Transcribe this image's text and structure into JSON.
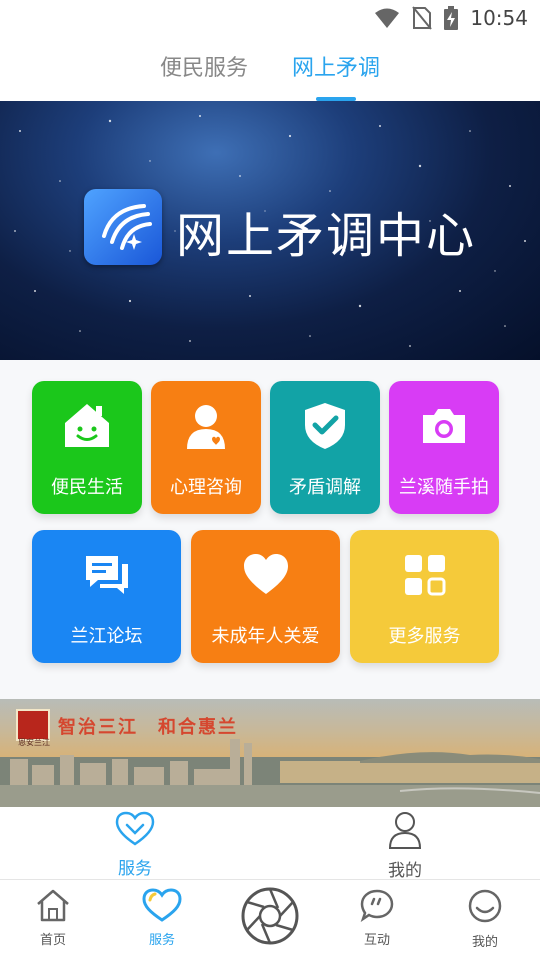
{
  "status": {
    "time": "10:54"
  },
  "tabs": [
    {
      "label": "便民服务",
      "active": false
    },
    {
      "label": "网上矛调",
      "active": true
    }
  ],
  "banner": {
    "title": "网上矛调中心"
  },
  "services": [
    {
      "label": "便民生活",
      "icon": "house-smile-icon",
      "color": "#1bc71b"
    },
    {
      "label": "心理咨询",
      "icon": "person-heart-icon",
      "color": "#f77f13"
    },
    {
      "label": "矛盾调解",
      "icon": "shield-check-icon",
      "color": "#12a3a6"
    },
    {
      "label": "兰溪随手拍",
      "icon": "camera-icon",
      "color": "#d83cf5"
    },
    {
      "label": "兰江论坛",
      "icon": "chat-icon",
      "color": "#1a86f3"
    },
    {
      "label": "未成年人关爱",
      "icon": "heart-icon",
      "color": "#f77f13"
    },
    {
      "label": "更多服务",
      "icon": "grid-icon",
      "color": "#f5ca3a"
    }
  ],
  "photo_banner": {
    "slogan": "智治三江　和合惠兰",
    "emblem_caption": "恩安兰江"
  },
  "sub_nav": [
    {
      "label": "服务",
      "icon": "heart-check-icon",
      "active": true
    },
    {
      "label": "我的",
      "icon": "person-icon",
      "active": false
    }
  ],
  "bottom_nav": [
    {
      "label": "首页",
      "icon": "home-icon",
      "active": false
    },
    {
      "label": "服务",
      "icon": "heart-icon",
      "active": true
    },
    {
      "label": "",
      "icon": "camera-shutter-icon",
      "active": false
    },
    {
      "label": "互动",
      "icon": "chat-bubble-icon",
      "active": false
    },
    {
      "label": "我的",
      "icon": "smile-icon",
      "active": false
    }
  ],
  "colors": {
    "accent": "#2aa4ee"
  }
}
